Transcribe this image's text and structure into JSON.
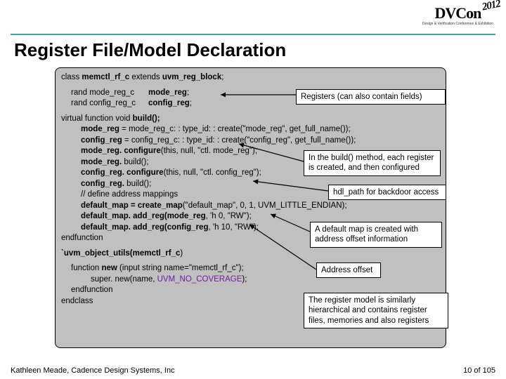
{
  "logo": {
    "main": "DVCon",
    "year": "2012",
    "sub": "Design & Verification Conference & Exhibition"
  },
  "title": "Register File/Model Declaration",
  "code": {
    "l1_a": "class ",
    "l1_b": "memctl_rf_c",
    "l1_c": " extends ",
    "l1_d": "uvm_reg_block",
    "l1_e": ";",
    "l2_a": "rand mode_reg_c",
    "l2_b": "mode_reg",
    "l2_c": ";",
    "l3_a": "rand config_reg_c",
    "l3_b": "config_reg",
    "l3_c": ";",
    "l4_a": "virtual function void ",
    "l4_b": "build();",
    "l5_a": "mode_reg",
    "l5_b": " = mode_reg_c: : type_id: : create(\"mode_reg\", get_full_name());",
    "l6_a": "config_reg",
    "l6_b": " = config_reg_c: : type_id: : create(\"config_reg\", get_full_name());",
    "l7_a": "mode_reg. configure",
    "l7_b": "(this, null, \"ctl. mode_reg\");",
    "l8_a": "mode_reg.",
    "l8_b": " build();",
    "l9_a": "config_reg. configure",
    "l9_b": "(this, null, \"ctl. config_reg\");",
    "l10_a": "config_reg.",
    "l10_b": " build();",
    "l11": "// define address mappings",
    "l12_a": "default_map = create_map",
    "l12_b": "(\"default_map\", 0, 1, UVM_LITTLE_ENDIAN);",
    "l13_a": "default_map. add_reg(mode_reg",
    "l13_b": ", 'h 0, \"RW\");",
    "l14_a": "default_map. add_reg(config_reg",
    "l14_b": ", 'h 10, \"RW\");",
    "l15": "endfunction",
    "l16_a": "`uvm_object_utils(memctl_rf_c",
    "l16_b": ")",
    "l17_a": "function ",
    "l17_b": "new",
    "l17_c": " (input string name=\"memctl_rf_c\");",
    "l18_a": "super. new(name, ",
    "l18_b": "UVM_NO_COVERAGE",
    "l18_c": ");",
    "l19": "endfunction",
    "l20": "endclass"
  },
  "callouts": {
    "c1": "Registers (can also contain fields)",
    "c2_a": "In the ",
    "c2_b": "build()",
    "c2_c": " method, each register is created, and then configured",
    "c3": "hdl_path for backdoor access",
    "c4": "A default map is created with address offset information",
    "c5": "Address offset",
    "c6": "The register model is similarly hierarchical and contains register files, memories and also registers"
  },
  "footer": {
    "left": "Kathleen Meade, Cadence Design Systems, Inc",
    "right": "10 of 105"
  }
}
